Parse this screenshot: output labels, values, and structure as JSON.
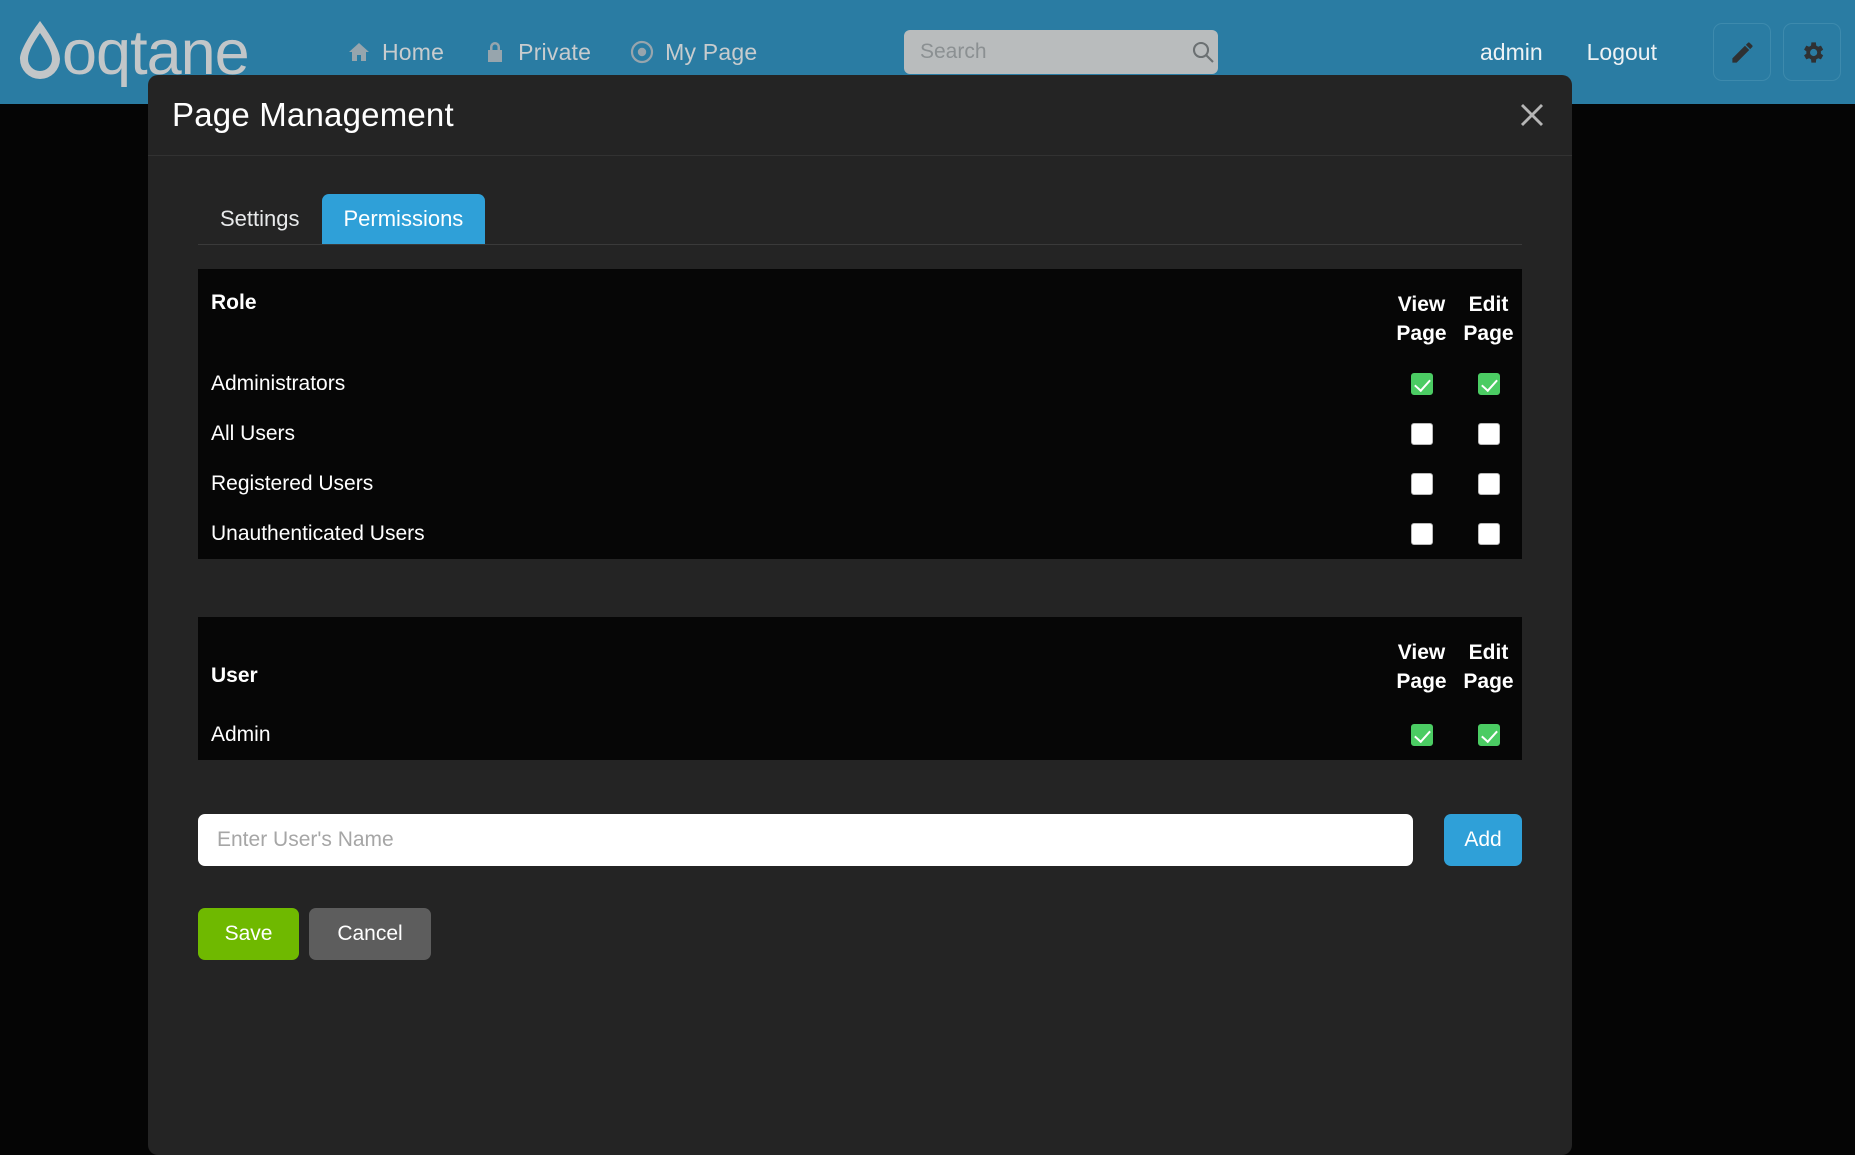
{
  "header": {
    "brand_name": "oqtane",
    "nav": [
      {
        "label": "Home",
        "icon": "home-icon"
      },
      {
        "label": "Private",
        "icon": "lock-icon"
      },
      {
        "label": "My Page",
        "icon": "target-icon"
      }
    ],
    "search": {
      "placeholder": "Search",
      "value": "",
      "button_icon": "search-icon"
    },
    "user": "admin",
    "logout": "Logout",
    "edit_icon": "pencil-icon",
    "settings_icon": "gear-icon",
    "background_color": "#2a7ca3"
  },
  "modal": {
    "title": "Page Management",
    "close_icon": "close-icon",
    "tabs": [
      {
        "label": "Settings",
        "active": false
      },
      {
        "label": "Permissions",
        "active": true
      }
    ],
    "accent_color": "#2fa0d8",
    "roles_table": {
      "columns": [
        "Role",
        "View Page",
        "Edit Page"
      ],
      "rows": [
        {
          "name": "Administrators",
          "view": true,
          "edit": true
        },
        {
          "name": "All Users",
          "view": false,
          "edit": false
        },
        {
          "name": "Registered Users",
          "view": false,
          "edit": false
        },
        {
          "name": "Unauthenticated Users",
          "view": false,
          "edit": false
        }
      ]
    },
    "users_table": {
      "columns": [
        "User",
        "View Page",
        "Edit Page"
      ],
      "rows": [
        {
          "name": "Admin",
          "view": true,
          "edit": true
        }
      ]
    },
    "add_user": {
      "placeholder": "Enter User's Name",
      "value": "",
      "button_label": "Add"
    },
    "footer": {
      "save_label": "Save",
      "cancel_label": "Cancel",
      "save_color": "#6fb900",
      "cancel_color": "#5d5d5d"
    }
  }
}
